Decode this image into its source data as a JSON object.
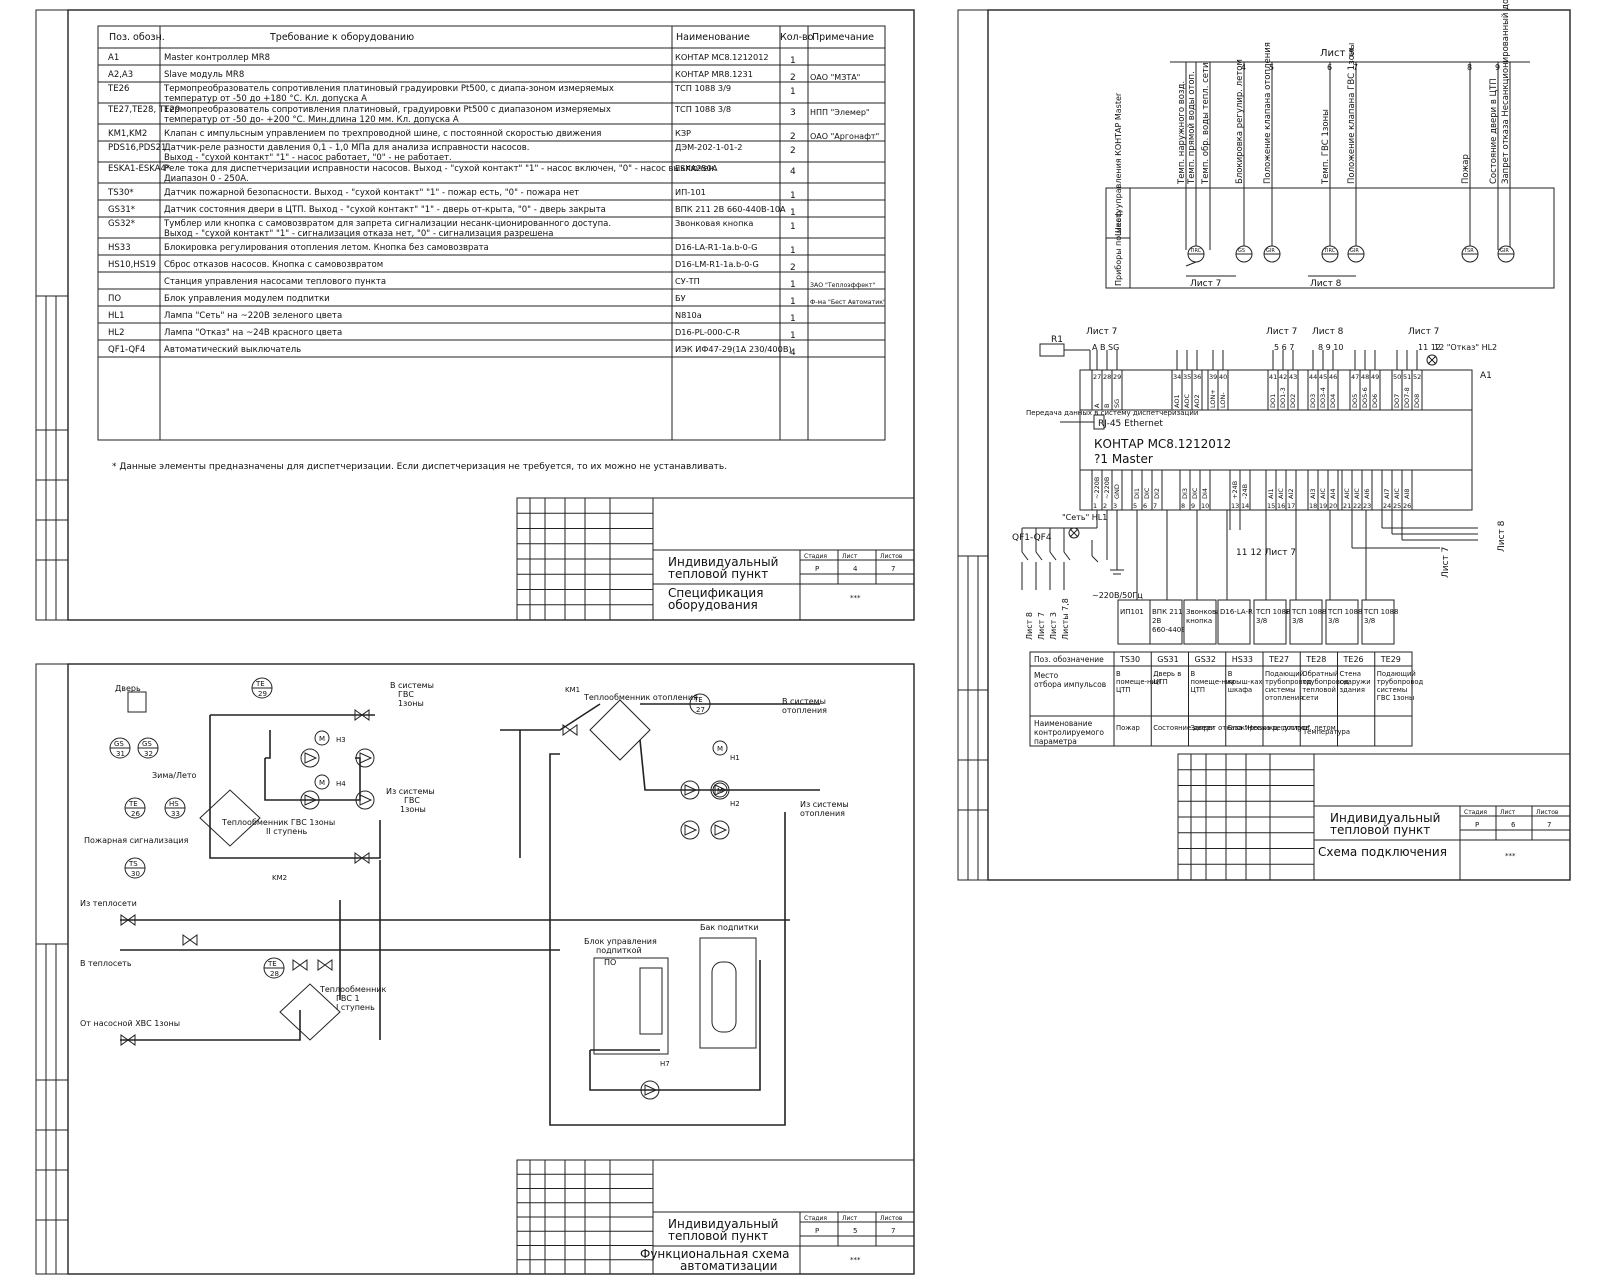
{
  "spec_sheet": {
    "headers": [
      "Поз. обозн.",
      "Требование к оборудованию",
      "Наименование",
      "Кол-во",
      "Примечание"
    ],
    "rows": [
      {
        "pos": "А1",
        "req": [
          "Master контроллер MR8"
        ],
        "name": "КОНТАР  МС8.1212012",
        "qty": "1",
        "note": ""
      },
      {
        "pos": "A2,A3",
        "req": [
          "Slave модуль MR8"
        ],
        "name": "КОНТАР  MR8.1231",
        "qty": "2",
        "note": "ОАО \"МЗТА\""
      },
      {
        "pos": "TE26",
        "req": [
          "Термопреобразователь сопротивления платиновый градуировки Pt500, с диапа-зоном измеряемых",
          "температур от -50 до +180 °С.   Кл. допуска А"
        ],
        "name": "ТСП 1088 3/9",
        "qty": "1",
        "note": ""
      },
      {
        "pos": "TE27,TE28, TE29",
        "req": [
          "Термопреобразователь сопротивления платиновый, градуировки Pt500 с диапазоном измеряемых",
          "температур от -50 до- +200 °С. Мин.длина 120 мм. Кл. допуска А"
        ],
        "name": "ТСП 1088 3/8",
        "qty": "3",
        "note": "НПП \"Элемер\""
      },
      {
        "pos": "KM1,KM2",
        "req": [
          "Клапан с  импульсным управлением по трехпроводной шине,  с постоянной скоростью движения"
        ],
        "name": "КЗР",
        "qty": "2",
        "note": "ОАО \"Аргонафт\""
      },
      {
        "pos": "PDS16,PDS21",
        "req": [
          "Датчик-реле разности давления 0,1 - 1,0 МПа для анализа исправности насосов.",
          "Выход - \"сухой контакт\" \"1\" - насос работает, \"0\" - не работает."
        ],
        "name": "ДЭМ-202-1-01-2",
        "qty": "2",
        "note": ""
      },
      {
        "pos": "ESKA1-ESKA4*",
        "req": [
          "Реле тока для диспетчеризации исправности насосов. Выход - \"сухой контакт\" \"1\" - насос включен, \"0\" - насос выключен.",
          "Диапазон 0 - 250А."
        ],
        "name": "ESKA250A",
        "qty": "4",
        "note": ""
      },
      {
        "pos": "TS30*",
        "req": [
          "Датчик пожарной безопасности. Выход - \"сухой контакт\" \"1\" - пожар есть, \"0\" - пожара нет"
        ],
        "name": "ИП-101",
        "qty": "1",
        "note": ""
      },
      {
        "pos": "GS31*",
        "req": [
          "Датчик состояния двери в ЦТП. Выход - \"сухой контакт\" \"1\" - дверь от-крыта, \"0\" - дверь закрыта"
        ],
        "name": "ВПК 211 2В 660-440В-10А",
        "qty": "1",
        "note": ""
      },
      {
        "pos": "GS32*",
        "req": [
          "Тумблер или кнопка с самовозвратом для запрета сигнализации несанк-ционированного доступа.",
          "Выход - \"сухой контакт\" \"1\" - сигнализация отказа нет, \"0\" - сигнализация разрешена"
        ],
        "name": "Звонковая кнопка",
        "qty": "1",
        "note": ""
      },
      {
        "pos": "HS33",
        "req": [
          "Блокировка регулирования отопления летом. Кнопка без самовозврата"
        ],
        "name": "D16-LA-R1-1a.b-0-G",
        "qty": "1",
        "note": ""
      },
      {
        "pos": "HS10,HS19",
        "req": [
          "Сброс отказов насосов. Кнопка с самовозвратом"
        ],
        "name": "D16-LM-R1-1a.b-0-G",
        "qty": "2",
        "note": ""
      },
      {
        "pos": "",
        "req": [
          "Станция управления насосами теплового пункта"
        ],
        "name": "СУ-ТП",
        "qty": "1",
        "note": "ЗАО \"Теплоэффект\""
      },
      {
        "pos": "ПО",
        "req": [
          "Блок управления модулем подпитки"
        ],
        "name": "БУ",
        "qty": "1",
        "note": "Ф-ма \"Бест Автоматик\""
      },
      {
        "pos": "HL1",
        "req": [
          "Лампа \"Сеть\" на ~220В зеленого цвета"
        ],
        "name": "N810a",
        "qty": "1",
        "note": ""
      },
      {
        "pos": "HL2",
        "req": [
          "Лампа \"Отказ\" на ~24В красного цвета"
        ],
        "name": "D16-PL-000-C-R",
        "qty": "1",
        "note": ""
      },
      {
        "pos": "QF1-QF4",
        "req": [
          "Автоматический выключатель"
        ],
        "name": "ИЭК ИФ47-29(1А 230/400В)",
        "qty": "4",
        "note": ""
      }
    ],
    "footnote": "* Данные элементы предназначены для диспетчеризации. Если диспетчеризация не требуется, то их можно не устанавливать.",
    "title_block": {
      "project": "Индивидуальный тепловой пункт",
      "sheet_title": "Спецификация оборудования",
      "col_labels": [
        "Стадия",
        "Лист",
        "Листов"
      ],
      "col_values": [
        "Р",
        "4",
        "7"
      ],
      "org": "***"
    }
  },
  "wiring_sheet": {
    "top_sheet_ref": "Лист 5",
    "top_columns": [
      {
        "num": "",
        "label": "Темп. наружного возд."
      },
      {
        "num": "",
        "label": "Темп. прямой воды отоп."
      },
      {
        "num": "",
        "label": "Темп. обр. воды тепл. сети"
      },
      {
        "num": "4",
        "label": "Блокировка регулир. летом"
      },
      {
        "num": "5",
        "label": "Положение клапана отопления"
      },
      {
        "num": "6",
        "label": "Темп. ГВС 1зоны"
      },
      {
        "num": "7",
        "label": "Положение клапана ГВС 1зоны"
      },
      {
        "num": "8",
        "label": "Пожар"
      },
      {
        "num": "9",
        "label": "Состояние двери в ЦТП"
      },
      {
        "num": "",
        "label": "Запрет отказа Несанкционированный доступ"
      }
    ],
    "left_labels": [
      "Приборы по месту",
      "Шкаф управления КОНТАР Master"
    ],
    "list7_left": "Лист 7",
    "list8_mid": "Лист 8",
    "sensors_top": [
      "TIRC",
      "GS",
      "GIR",
      "TIRC",
      "GIR",
      "TSR",
      "GIR"
    ],
    "controller": {
      "name": "КОНТАР  МС8.1212012",
      "sub": "?1  Master",
      "position": "А1",
      "r1": "R1",
      "rj": "RJ-45 Ethernet",
      "side_label": "Передача данных в систему диспетчеризации",
      "top_refs": [
        "Лист 7",
        "Лист 7",
        "Лист 8",
        "Лист 7"
      ],
      "top_ref_nums": [
        "A B SG",
        "5 6 7",
        "8 9 10",
        "11 12"
      ],
      "top_terms": [
        "27",
        "28",
        "29",
        "34",
        "35",
        "36",
        "39",
        "40",
        "41",
        "42",
        "43",
        "44",
        "45",
        "46",
        "47",
        "48",
        "49",
        "50",
        "51",
        "52"
      ],
      "top_sigs": [
        "A",
        "B",
        "SG",
        "AO1",
        "AOC",
        "AO2",
        "LON+",
        "LON-",
        "DO1",
        "DO1-3",
        "DO2",
        "DO3",
        "DO3-4",
        "DO4",
        "DO5",
        "DO5-6",
        "DO6",
        "DO7",
        "DO7-8",
        "DO8"
      ],
      "bot_sigs": [
        "~220В",
        "~220В",
        "GND",
        "DI1",
        "DIC",
        "DI2",
        "DI3",
        "DIC",
        "DI4",
        "+24В",
        "-24В",
        "AI1",
        "AIC",
        "AI2",
        "AI3",
        "AIC",
        "AI4",
        "AIC",
        "AIC",
        "AI6",
        "AI7",
        "AIC",
        "AI8"
      ],
      "bot_terms": [
        "1",
        "2",
        "3",
        "5",
        "6",
        "7",
        "8",
        "9",
        "10",
        "13",
        "14",
        "15",
        "16",
        "17",
        "18",
        "19",
        "20",
        "21",
        "22",
        "23",
        "24",
        "25",
        "26"
      ],
      "hl2": "12 \"Отказ\" HL2",
      "hl1": "\"Сеть\" HL1",
      "qf": "QF1-QF4",
      "power": "~220В/50Гц",
      "list7_bottom": "11 12 Лист 7",
      "sheets_lower": [
        "Лист 8",
        "Лист 7"
      ],
      "left_vert": [
        "Лист 8",
        "Лист 7",
        "Лист 3",
        "Листы 7,8"
      ]
    },
    "devices": [
      "ИП101",
      "ВПК 211 2В 660-440В-10А",
      "Звонковая кнопка",
      "D16-LA-R1-1ab-0-G",
      "ТСП 1088 3/8",
      "ТСП 1088 3/8",
      "ТСП 1088 3/8",
      "ТСП 1088 3/8"
    ],
    "table": {
      "row_labels": [
        "Поз. обозначение",
        "Место отбора импульсов",
        "Наименование контролируемого параметра"
      ],
      "cols": [
        "TS30",
        "GS31",
        "GS32",
        "HS33",
        "TE27",
        "TE28",
        "TE26",
        "TE29"
      ],
      "places": [
        "В помеще-нии ЦТП",
        "Дверь в ЦТП",
        "В помеще-нии ЦТП",
        "В крыш-ках шкафа",
        "Подающий трубопровод системы отопления",
        "Обратный трубопровод тепловой сети",
        "Стена снаружи здания",
        "Подающий трубопровод системы ГВС 1зоны"
      ],
      "params": [
        "Пожар",
        "Состояние двери",
        "Запрет отказа \"Несанкц. доступ\"",
        "Блокировка регулиров. летом",
        "Температура"
      ]
    },
    "title_block": {
      "project": "Индивидуальный тепловой пункт",
      "sheet_title": "Схема подключения",
      "col_labels": [
        "Стадия",
        "Лист",
        "Листов"
      ],
      "col_values": [
        "Р",
        "6",
        "7"
      ],
      "org": "***"
    }
  },
  "functional_sheet": {
    "labels": {
      "door": "Дверь",
      "winter_summer": "Зима/Лето",
      "fire": "Пожарная сигнализация",
      "to_gvs": "В систему ГВС 1зоны",
      "from_gvs": "Из системы ГВС 1зоны",
      "hx_heat": "Теплообменник отопления",
      "to_heating": "В систему отопления",
      "from_heating": "Из системы отопления",
      "hx_gvs2": "Теплообменник ГВС 1зоны II ступень",
      "hx_gvs1": "Теплообменник ГВС 1 I ступень",
      "from_network": "Из теплосети",
      "to_network": "В теплосеть",
      "from_xvs": "От насосной ХВС 1зоны",
      "makeup_block": "Блок управления подпиткой",
      "makeup_tank": "Бак подпитки",
      "po": "ПО"
    },
    "tags": [
      "GS 31",
      "GS 32",
      "TE 26",
      "HS 33",
      "TS 30",
      "TE 29",
      "TE 27",
      "TE 28",
      "KM1",
      "KM2",
      "H1",
      "H2",
      "H3",
      "H4",
      "H7"
    ],
    "title_block": {
      "project": "Индивидуальный тепловой пункт",
      "sheet_title": "Функциональная схема автоматизации",
      "col_labels": [
        "Стадия",
        "Лист",
        "Листов"
      ],
      "col_values": [
        "Р",
        "5",
        "7"
      ],
      "org": "***"
    }
  }
}
